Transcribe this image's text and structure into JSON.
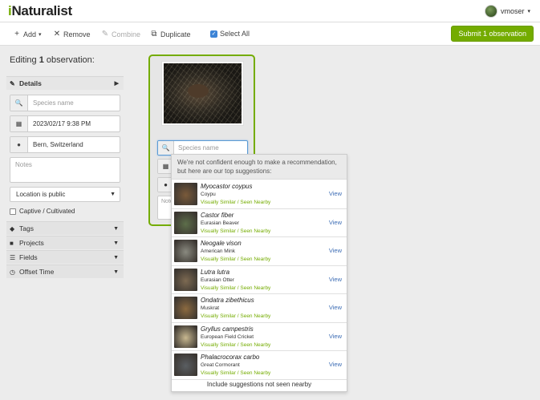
{
  "navbar": {
    "logo_prefix": "i",
    "logo_rest": "Naturalist",
    "username": "vmoser"
  },
  "toolbar": {
    "add_label": "Add",
    "remove_label": "Remove",
    "combine_label": "Combine",
    "duplicate_label": "Duplicate",
    "select_all_label": "Select All",
    "submit_label": "Submit 1 observation"
  },
  "sidebar": {
    "editing_prefix": "Editing ",
    "editing_count": "1",
    "editing_suffix": " observation:",
    "details_label": "Details",
    "species_placeholder": "Species name",
    "date_value": "2023/02/17 9:38 PM",
    "location_value": "Bern, Switzerland",
    "notes_placeholder": "Notes",
    "geoprivacy_value": "Location is public",
    "captive_label": "Captive / Cultivated",
    "sections": [
      {
        "label": "Tags"
      },
      {
        "label": "Projects"
      },
      {
        "label": "Fields"
      },
      {
        "label": "Offset Time"
      }
    ]
  },
  "card": {
    "species_placeholder": "Species name",
    "notes_placeholder": "Note"
  },
  "suggestions": {
    "header": "We're not confident enough to make a recommendation, but here are our top suggestions:",
    "view_label": "View",
    "reason_label": "Visually Similar / Seen Nearby",
    "items": [
      {
        "scientific": "Myocastor coypus",
        "common": "Coypu",
        "thumb_color": "#7a5a3a"
      },
      {
        "scientific": "Castor fiber",
        "common": "Eurasian Beaver",
        "thumb_color": "#5d6e4a"
      },
      {
        "scientific": "Neogale vison",
        "common": "American Mink",
        "thumb_color": "#8a8a80"
      },
      {
        "scientific": "Lutra lutra",
        "common": "Eurasian Otter",
        "thumb_color": "#7d6a52"
      },
      {
        "scientific": "Ondatra zibethicus",
        "common": "Muskrat",
        "thumb_color": "#8c6a40"
      },
      {
        "scientific": "Gryllus campestris",
        "common": "European Field Cricket",
        "thumb_color": "#c8b890"
      },
      {
        "scientific": "Phalacrocorax carbo",
        "common": "Great Cormorant",
        "thumb_color": "#5a5e62"
      }
    ],
    "footer": "Include suggestions not seen nearby"
  }
}
